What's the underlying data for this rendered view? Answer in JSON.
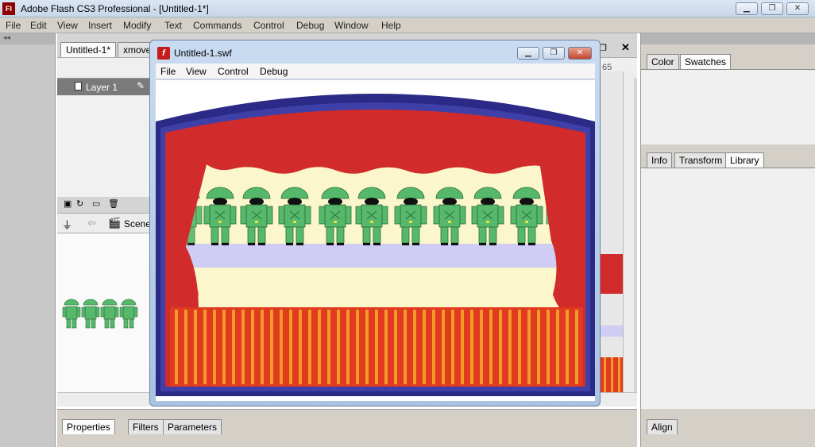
{
  "app": {
    "title": "Adobe Flash CS3 Professional - [Untitled-1*]",
    "icon_text": "Fl"
  },
  "window_controls": {
    "minimize": "▁",
    "restore": "❐",
    "close": "✕"
  },
  "menubar": [
    "File",
    "Edit",
    "View",
    "Insert",
    "Modify",
    "Text",
    "Commands",
    "Control",
    "Debug",
    "Window",
    "Help"
  ],
  "doc_tabs": [
    {
      "label": "Untitled-1*"
    },
    {
      "label": "xmove"
    }
  ],
  "timeline": {
    "layer_name": "Layer 1",
    "frame_number": "65"
  },
  "scene": {
    "label": "Scene"
  },
  "right_panels": {
    "top_tabs": [
      "Color",
      "Swatches"
    ],
    "mid_tabs": [
      "Info",
      "Transform",
      "Library"
    ],
    "bottom_tabs": [
      "Align"
    ]
  },
  "properties_tabs": [
    "Properties",
    "Filters",
    "Parameters"
  ],
  "swf_window": {
    "title": "Untitled-1.swf",
    "icon_text": "f",
    "menu": [
      "File",
      "View",
      "Control",
      "Debug"
    ]
  },
  "colors": {
    "curtain_red": "#d12b2b",
    "border_navy": "#2b2a86",
    "frame_blue": "#3f3fa8",
    "stage_cream": "#fbf6cb",
    "stripe_lavender": "#cfcdf3",
    "floor_orange": "#f39a2a",
    "figure_green": "#56b86b"
  }
}
